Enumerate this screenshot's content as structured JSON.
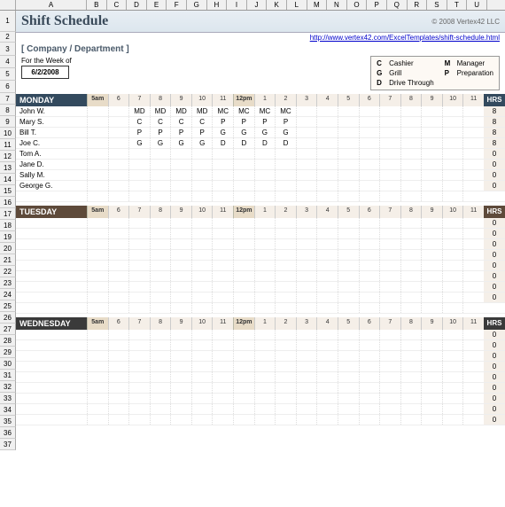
{
  "cols": [
    "A",
    "B",
    "C",
    "D",
    "E",
    "F",
    "G",
    "H",
    "I",
    "J",
    "K",
    "L",
    "M",
    "N",
    "O",
    "P",
    "Q",
    "R",
    "S",
    "T",
    "U"
  ],
  "rows": [
    "1",
    "2",
    "3",
    "4",
    "5",
    "6",
    "7",
    "8",
    "9",
    "10",
    "11",
    "12",
    "13",
    "14",
    "15",
    "16",
    "17",
    "18",
    "19",
    "20",
    "21",
    "22",
    "23",
    "24",
    "25",
    "26",
    "27",
    "28",
    "29",
    "30",
    "31",
    "32",
    "33",
    "34",
    "35",
    "36",
    "37"
  ],
  "title": "Shift Schedule",
  "copyright": "© 2008 Vertex42 LLC",
  "link": "http://www.vertex42.com/ExcelTemplates/shift-schedule.html",
  "company": "[ Company / Department ]",
  "week": {
    "label": "For the Week of",
    "date": "6/2/2008"
  },
  "legend": {
    "col1": [
      {
        "code": "C",
        "name": "Cashier"
      },
      {
        "code": "G",
        "name": "Grill"
      },
      {
        "code": "D",
        "name": "Drive Through"
      }
    ],
    "col2": [
      {
        "code": "M",
        "name": "Manager"
      },
      {
        "code": "P",
        "name": "Preparation"
      }
    ]
  },
  "times": [
    "5am",
    "6",
    "7",
    "8",
    "9",
    "10",
    "11",
    "12pm",
    "1",
    "2",
    "3",
    "4",
    "5",
    "6",
    "7",
    "8",
    "9",
    "10",
    "11"
  ],
  "hrs_label": "HRS",
  "days": [
    {
      "name": "MONDAY",
      "class": "monday",
      "rows": [
        {
          "emp": "John W.",
          "shifts": [
            "",
            "",
            "MD",
            "MD",
            "MD",
            "MD",
            "MC",
            "MC",
            "MC",
            "MC",
            "",
            "",
            "",
            "",
            "",
            "",
            "",
            "",
            ""
          ],
          "hrs": "8"
        },
        {
          "emp": "Mary S.",
          "shifts": [
            "",
            "",
            "C",
            "C",
            "C",
            "C",
            "P",
            "P",
            "P",
            "P",
            "",
            "",
            "",
            "",
            "",
            "",
            "",
            "",
            ""
          ],
          "hrs": "8"
        },
        {
          "emp": "Bill T.",
          "shifts": [
            "",
            "",
            "P",
            "P",
            "P",
            "P",
            "G",
            "G",
            "G",
            "G",
            "",
            "",
            "",
            "",
            "",
            "",
            "",
            "",
            ""
          ],
          "hrs": "8"
        },
        {
          "emp": "Joe C.",
          "shifts": [
            "",
            "",
            "G",
            "G",
            "G",
            "G",
            "D",
            "D",
            "D",
            "D",
            "",
            "",
            "",
            "",
            "",
            "",
            "",
            "",
            ""
          ],
          "hrs": "8"
        },
        {
          "emp": "Tom A.",
          "shifts": [
            "",
            "",
            "",
            "",
            "",
            "",
            "",
            "",
            "",
            "",
            "",
            "",
            "",
            "",
            "",
            "",
            "",
            "",
            ""
          ],
          "hrs": "0"
        },
        {
          "emp": "Jane D.",
          "shifts": [
            "",
            "",
            "",
            "",
            "",
            "",
            "",
            "",
            "",
            "",
            "",
            "",
            "",
            "",
            "",
            "",
            "",
            "",
            ""
          ],
          "hrs": "0"
        },
        {
          "emp": "Sally M.",
          "shifts": [
            "",
            "",
            "",
            "",
            "",
            "",
            "",
            "",
            "",
            "",
            "",
            "",
            "",
            "",
            "",
            "",
            "",
            "",
            ""
          ],
          "hrs": "0"
        },
        {
          "emp": "George G.",
          "shifts": [
            "",
            "",
            "",
            "",
            "",
            "",
            "",
            "",
            "",
            "",
            "",
            "",
            "",
            "",
            "",
            "",
            "",
            "",
            ""
          ],
          "hrs": "0"
        }
      ]
    },
    {
      "name": "TUESDAY",
      "class": "tuesday",
      "rows": [
        {
          "emp": "",
          "shifts": [
            "",
            "",
            "",
            "",
            "",
            "",
            "",
            "",
            "",
            "",
            "",
            "",
            "",
            "",
            "",
            "",
            "",
            "",
            ""
          ],
          "hrs": "0"
        },
        {
          "emp": "",
          "shifts": [
            "",
            "",
            "",
            "",
            "",
            "",
            "",
            "",
            "",
            "",
            "",
            "",
            "",
            "",
            "",
            "",
            "",
            "",
            ""
          ],
          "hrs": "0"
        },
        {
          "emp": "",
          "shifts": [
            "",
            "",
            "",
            "",
            "",
            "",
            "",
            "",
            "",
            "",
            "",
            "",
            "",
            "",
            "",
            "",
            "",
            "",
            ""
          ],
          "hrs": "0"
        },
        {
          "emp": "",
          "shifts": [
            "",
            "",
            "",
            "",
            "",
            "",
            "",
            "",
            "",
            "",
            "",
            "",
            "",
            "",
            "",
            "",
            "",
            "",
            ""
          ],
          "hrs": "0"
        },
        {
          "emp": "",
          "shifts": [
            "",
            "",
            "",
            "",
            "",
            "",
            "",
            "",
            "",
            "",
            "",
            "",
            "",
            "",
            "",
            "",
            "",
            "",
            ""
          ],
          "hrs": "0"
        },
        {
          "emp": "",
          "shifts": [
            "",
            "",
            "",
            "",
            "",
            "",
            "",
            "",
            "",
            "",
            "",
            "",
            "",
            "",
            "",
            "",
            "",
            "",
            ""
          ],
          "hrs": "0"
        },
        {
          "emp": "",
          "shifts": [
            "",
            "",
            "",
            "",
            "",
            "",
            "",
            "",
            "",
            "",
            "",
            "",
            "",
            "",
            "",
            "",
            "",
            "",
            ""
          ],
          "hrs": "0"
        },
        {
          "emp": "",
          "shifts": [
            "",
            "",
            "",
            "",
            "",
            "",
            "",
            "",
            "",
            "",
            "",
            "",
            "",
            "",
            "",
            "",
            "",
            "",
            ""
          ],
          "hrs": "0"
        }
      ]
    },
    {
      "name": "WEDNESDAY",
      "class": "wednesday",
      "rows": [
        {
          "emp": "",
          "shifts": [
            "",
            "",
            "",
            "",
            "",
            "",
            "",
            "",
            "",
            "",
            "",
            "",
            "",
            "",
            "",
            "",
            "",
            "",
            ""
          ],
          "hrs": "0"
        },
        {
          "emp": "",
          "shifts": [
            "",
            "",
            "",
            "",
            "",
            "",
            "",
            "",
            "",
            "",
            "",
            "",
            "",
            "",
            "",
            "",
            "",
            "",
            ""
          ],
          "hrs": "0"
        },
        {
          "emp": "",
          "shifts": [
            "",
            "",
            "",
            "",
            "",
            "",
            "",
            "",
            "",
            "",
            "",
            "",
            "",
            "",
            "",
            "",
            "",
            "",
            ""
          ],
          "hrs": "0"
        },
        {
          "emp": "",
          "shifts": [
            "",
            "",
            "",
            "",
            "",
            "",
            "",
            "",
            "",
            "",
            "",
            "",
            "",
            "",
            "",
            "",
            "",
            "",
            ""
          ],
          "hrs": "0"
        },
        {
          "emp": "",
          "shifts": [
            "",
            "",
            "",
            "",
            "",
            "",
            "",
            "",
            "",
            "",
            "",
            "",
            "",
            "",
            "",
            "",
            "",
            "",
            ""
          ],
          "hrs": "0"
        },
        {
          "emp": "",
          "shifts": [
            "",
            "",
            "",
            "",
            "",
            "",
            "",
            "",
            "",
            "",
            "",
            "",
            "",
            "",
            "",
            "",
            "",
            "",
            ""
          ],
          "hrs": "0"
        },
        {
          "emp": "",
          "shifts": [
            "",
            "",
            "",
            "",
            "",
            "",
            "",
            "",
            "",
            "",
            "",
            "",
            "",
            "",
            "",
            "",
            "",
            "",
            ""
          ],
          "hrs": "0"
        },
        {
          "emp": "",
          "shifts": [
            "",
            "",
            "",
            "",
            "",
            "",
            "",
            "",
            "",
            "",
            "",
            "",
            "",
            "",
            "",
            "",
            "",
            "",
            ""
          ],
          "hrs": "0"
        },
        {
          "emp": "",
          "shifts": [
            "",
            "",
            "",
            "",
            "",
            "",
            "",
            "",
            "",
            "",
            "",
            "",
            "",
            "",
            "",
            "",
            "",
            "",
            ""
          ],
          "hrs": "0"
        }
      ]
    }
  ]
}
